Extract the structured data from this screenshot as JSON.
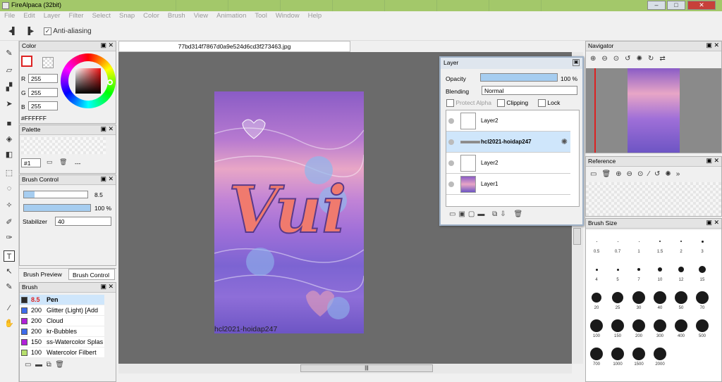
{
  "app": {
    "title": "FireAlpaca (32bit)"
  },
  "menu": [
    "File",
    "Edit",
    "Layer",
    "Filter",
    "Select",
    "Snap",
    "Color",
    "Brush",
    "View",
    "Animation",
    "Tool",
    "Window",
    "Help"
  ],
  "toolbar": {
    "antialias_label": "Anti-aliasing",
    "antialias_checked": true
  },
  "document": {
    "tab_title": "77bd314f7867d0a9e524d6cd3f273463.jpg",
    "watermark": "hcl2021-hoidap247"
  },
  "color_panel": {
    "title": "Color",
    "r_label": "R",
    "g_label": "G",
    "b_label": "B",
    "r": "255",
    "g": "255",
    "b": "255",
    "hex": "#FFFFFF"
  },
  "palette_panel": {
    "title": "Palette",
    "select": "#1",
    "dash": "---"
  },
  "brush_control": {
    "title": "Brush Control",
    "size": "8.5",
    "opacity": "100 %",
    "stabilizer_label": "Stabilizer",
    "stabilizer": "40"
  },
  "brush_tabs": {
    "preview": "Brush Preview",
    "control": "Brush Control"
  },
  "brush_panel": {
    "title": "Brush",
    "items": [
      {
        "size": "8.5",
        "name": "Pen",
        "color": "#2a2a2a"
      },
      {
        "size": "200",
        "name": "Glitter (Light) [Add",
        "color": "#3d6bea"
      },
      {
        "size": "200",
        "name": "Cloud",
        "color": "#b020d8"
      },
      {
        "size": "200",
        "name": "kr-Bubbles",
        "color": "#3d6bea"
      },
      {
        "size": "150",
        "name": "ss-Watercolor Splas",
        "color": "#b020d8"
      },
      {
        "size": "100",
        "name": "Watercolor Filbert",
        "color": "#b6df6c"
      }
    ]
  },
  "layer_panel": {
    "title": "Layer",
    "opacity_label": "Opacity",
    "opacity": "100 %",
    "blending_label": "Blending",
    "blending": "Normal",
    "protect_alpha": "Protect Alpha",
    "clipping": "Clipping",
    "lock": "Lock",
    "layers": [
      {
        "name": "Layer2",
        "selected": false
      },
      {
        "name": "hcl2021-hoidap247",
        "selected": true
      },
      {
        "name": "Layer2",
        "selected": false
      },
      {
        "name": "Layer1",
        "selected": false
      }
    ]
  },
  "navigator": {
    "title": "Navigator"
  },
  "reference": {
    "title": "Reference"
  },
  "brush_size": {
    "title": "Brush Size",
    "sizes": [
      "0.5",
      "0.7",
      "1",
      "1.5",
      "2",
      "3",
      "4",
      "5",
      "7",
      "10",
      "12",
      "15",
      "20",
      "25",
      "30",
      "40",
      "50",
      "70",
      "100",
      "150",
      "200",
      "300",
      "400",
      "500",
      "700",
      "1000",
      "1500",
      "2000"
    ]
  },
  "colors": {
    "accent": "#a3c86a",
    "selection": "#cfe6fb"
  }
}
